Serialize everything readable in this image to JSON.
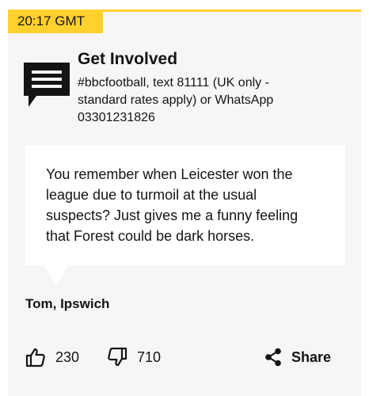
{
  "post": {
    "timestamp": "20:17 GMT"
  },
  "get_involved": {
    "title": "Get Involved",
    "description": "#bbcfootball, text 81111 (UK only - standard rates apply) or WhatsApp 03301231826",
    "icon": "speech-bubble-icon"
  },
  "comment": {
    "quote": "You remember when Leicester won the league due to turmoil at the usual suspects? Just gives me a funny feeling that Forest could be dark horses.",
    "author": "Tom, Ipswich"
  },
  "reactions": {
    "like_count": "230",
    "like_icon": "thumbs-up-icon",
    "dislike_count": "710",
    "dislike_icon": "thumbs-down-icon",
    "share_label": "Share",
    "share_icon": "share-icon"
  },
  "colors": {
    "accent": "#fed12f",
    "card_background": "#f6f6f6",
    "text": "#141414"
  }
}
